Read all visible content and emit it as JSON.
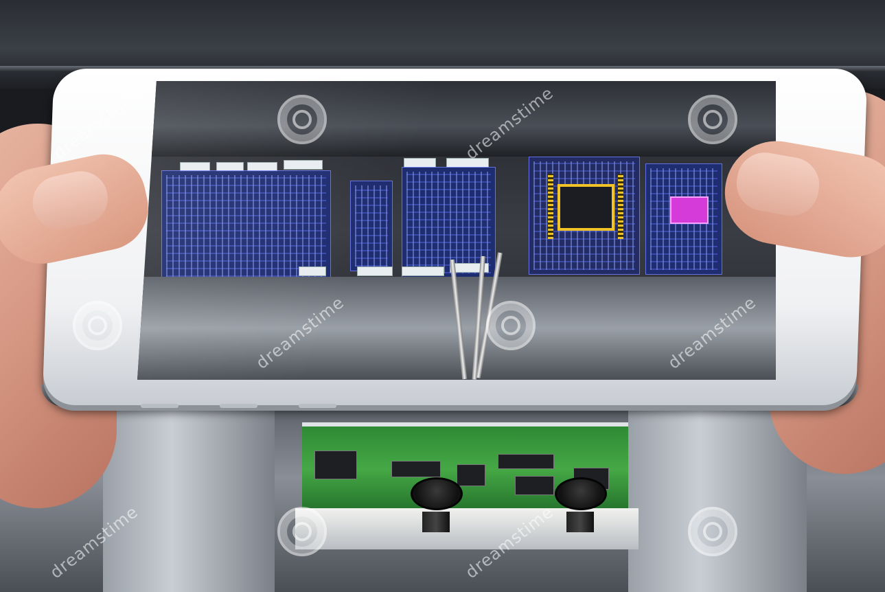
{
  "watermark": {
    "text": "dreamstime"
  }
}
